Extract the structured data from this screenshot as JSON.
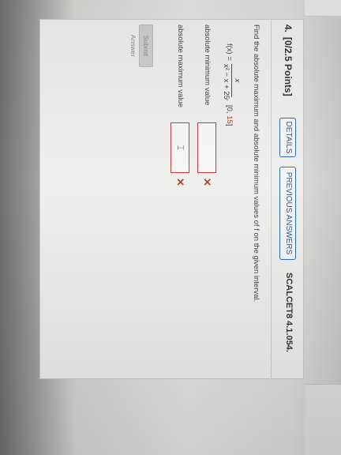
{
  "question": {
    "number": "4.",
    "points": "[0/2.5 Points]",
    "details_label": "DETAILS",
    "previous_answers_label": "PREVIOUS ANSWERS",
    "source": "SCALCET8 4.1.054.",
    "prompt": "Find the absolute maximum and absolute minimum values of f on the given interval.",
    "function": {
      "lhs": "f(x) =",
      "numerator": "x",
      "denominator": "x² − x + 25",
      "separator": ",",
      "interval_open": "[0,",
      "interval_value": "15",
      "interval_close": "]"
    },
    "answers": [
      {
        "label": "absolute minimum value",
        "value": "",
        "status": "incorrect",
        "mark": "✕"
      },
      {
        "label": "absolute maximum value",
        "value": "",
        "status": "incorrect",
        "mark": "✕"
      }
    ],
    "submit_label": "Submit Answer"
  },
  "colors": {
    "accent": "#2f6fb3",
    "error": "#c0392b",
    "card_background": "#efefec"
  }
}
